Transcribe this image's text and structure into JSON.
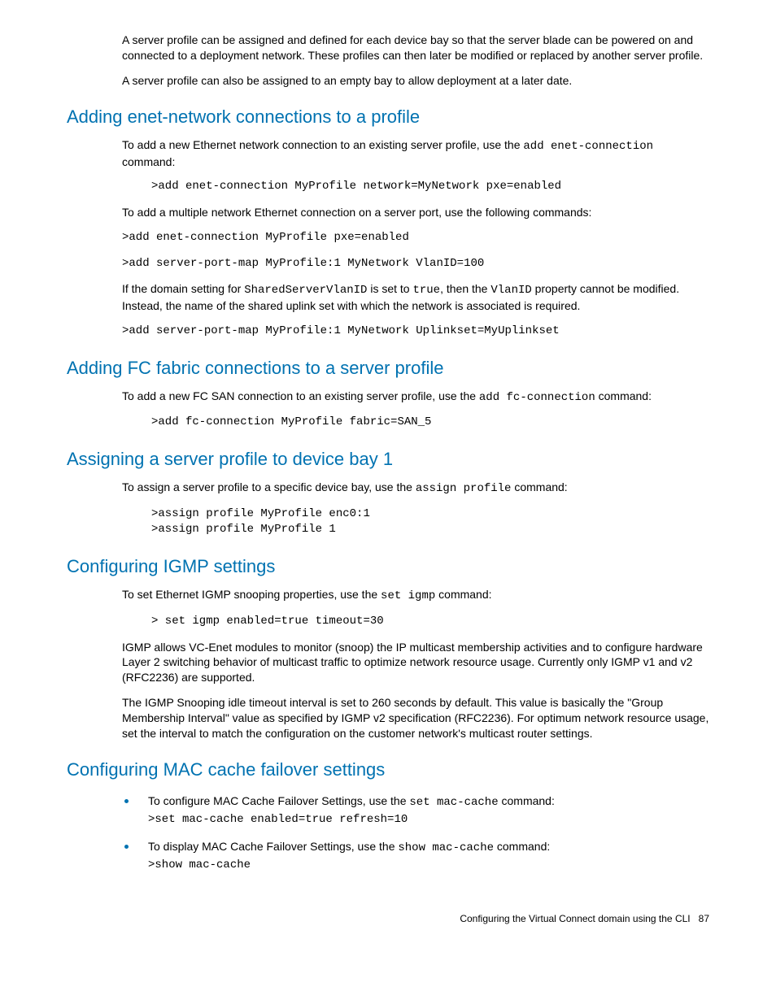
{
  "intro": {
    "p1": "A server profile can be assigned and defined for each device bay so that the server blade can be powered on and connected to a deployment network. These profiles can then later be modified or replaced by another server profile.",
    "p2": "A server profile can also be assigned to an empty bay to allow deployment at a later date."
  },
  "sections": {
    "enet": {
      "heading": "Adding enet-network connections to a profile",
      "p1a": "To add a new Ethernet network connection to an existing server profile, use the ",
      "p1code": "add enet-connection",
      "p1b": " command:",
      "code1": ">add enet-connection MyProfile network=MyNetwork pxe=enabled",
      "p2": "To add a multiple network Ethernet connection on a server port, use the following commands:",
      "code2": ">add enet-connection MyProfile pxe=enabled",
      "code3": ">add server-port-map MyProfile:1 MyNetwork VlanID=100",
      "p3a": "If the domain setting for ",
      "p3code1": "SharedServerVlanID",
      "p3b": " is set to ",
      "p3code2": "true",
      "p3c": ", then the ",
      "p3code3": "VlanID",
      "p3d": " property cannot be modified. Instead, the name of the shared uplink set with which the network is associated is required.",
      "code4": ">add server-port-map MyProfile:1 MyNetwork Uplinkset=MyUplinkset"
    },
    "fc": {
      "heading": "Adding FC fabric connections to a server profile",
      "p1a": "To add a new FC SAN connection to an existing server profile, use the ",
      "p1code": "add fc-connection",
      "p1b": " command:",
      "code1": ">add fc-connection MyProfile fabric=SAN_5"
    },
    "assign": {
      "heading": "Assigning a server profile to device bay 1",
      "p1a": "To assign a server profile to a specific device bay, use the ",
      "p1code": "assign profile",
      "p1b": " command:",
      "code1": ">assign profile MyProfile enc0:1\n>assign profile MyProfile 1"
    },
    "igmp": {
      "heading": "Configuring IGMP settings",
      "p1a": "To set Ethernet IGMP snooping properties, use the ",
      "p1code": "set igmp",
      "p1b": " command:",
      "code1": "> set igmp enabled=true timeout=30",
      "p2": "IGMP allows VC-Enet modules to monitor (snoop) the IP multicast membership activities and to configure hardware Layer 2 switching behavior of multicast traffic to optimize network resource usage. Currently only IGMP v1 and v2 (RFC2236) are supported.",
      "p3": "The IGMP Snooping idle timeout interval is set to 260 seconds by default. This value is basically the \"Group Membership Interval\" value as specified by IGMP v2 specification (RFC2236). For optimum network resource usage, set the interval to match the configuration on the customer network's multicast router settings."
    },
    "mac": {
      "heading": "Configuring MAC cache failover settings",
      "li1a": "To configure MAC Cache Failover Settings, use the ",
      "li1code": "set mac-cache",
      "li1b": " command:",
      "li1cmd": ">set mac-cache enabled=true refresh=10",
      "li2a": "To display MAC Cache Failover Settings, use the ",
      "li2code": "show mac-cache",
      "li2b": " command:",
      "li2cmd": ">show mac-cache"
    }
  },
  "footer": {
    "text": "Configuring the Virtual Connect domain using the CLI",
    "page": "87"
  }
}
